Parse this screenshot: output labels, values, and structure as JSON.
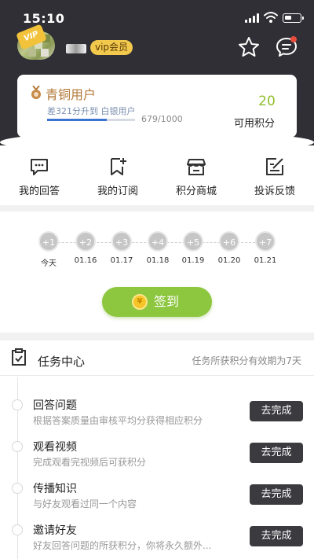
{
  "status_bar": {
    "time": "15:10"
  },
  "profile": {
    "vip_tag": "VIP",
    "vip_badge": "vip会员"
  },
  "level_card": {
    "level_name": "青铜用户",
    "progress_text": "差321分升到 白银用户",
    "progress_count": "679/1000",
    "progress_fraction": 0.679,
    "points_value": "20",
    "points_label": "可用积分"
  },
  "shortcuts": [
    {
      "label": "我的回答",
      "icon": "chat-icon"
    },
    {
      "label": "我的订阅",
      "icon": "bookmark-add-icon"
    },
    {
      "label": "积分商城",
      "icon": "shop-icon"
    },
    {
      "label": "投诉反馈",
      "icon": "edit-icon"
    }
  ],
  "checkin": {
    "days": [
      {
        "bonus": "+1",
        "label": "今天"
      },
      {
        "bonus": "+2",
        "label": "01.16"
      },
      {
        "bonus": "+3",
        "label": "01.17"
      },
      {
        "bonus": "+4",
        "label": "01.18"
      },
      {
        "bonus": "+5",
        "label": "01.19"
      },
      {
        "bonus": "+6",
        "label": "01.20"
      },
      {
        "bonus": "+7",
        "label": "01.21"
      }
    ],
    "button_label": "签到"
  },
  "tasks": {
    "title": "任务中心",
    "note": "任务所获积分有效期为7天",
    "items": [
      {
        "name": "回答问题",
        "desc": "根据答案质量由审核平均分获得相应积分",
        "button": "去完成"
      },
      {
        "name": "观看视频",
        "desc": "完成观看完视频后可获积分",
        "button": "去完成"
      },
      {
        "name": "传播知识",
        "desc": "与好友观看过同一个内容",
        "button": "去完成"
      },
      {
        "name": "邀请好友",
        "desc": "好友回答问题的所获积分，你将永久额外...",
        "button": "去完成"
      }
    ]
  },
  "colors": {
    "header_bg": "#2f2f35",
    "accent_green": "#8dc63f",
    "bronze": "#b47a3a",
    "progress_blue": "#3a73d0"
  }
}
